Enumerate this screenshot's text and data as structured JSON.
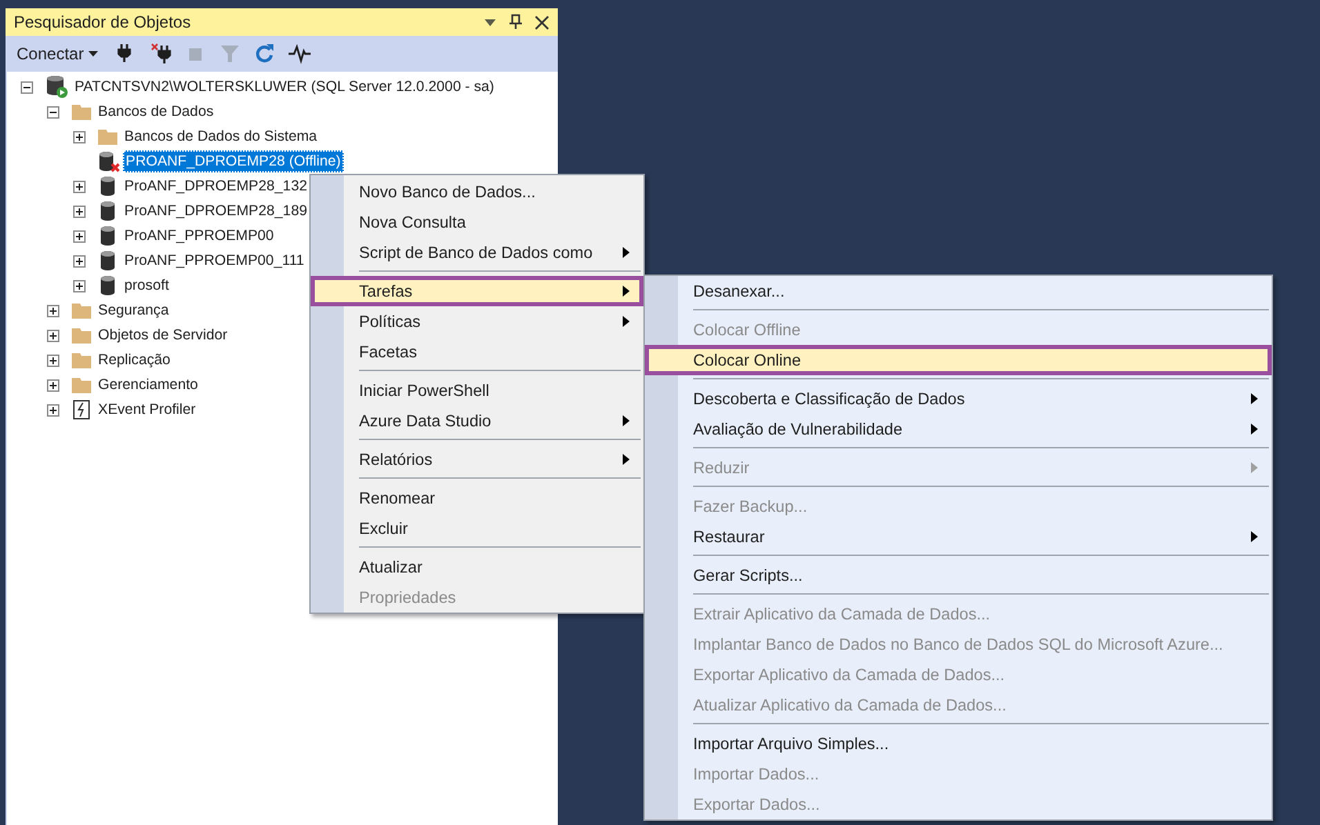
{
  "panel": {
    "title": "Pesquisador de Objetos",
    "title_controls": [
      {
        "kind": "dropdown"
      },
      {
        "kind": "pin"
      },
      {
        "kind": "close"
      }
    ],
    "toolbar": {
      "connect_label": "Conectar",
      "tools": [
        {
          "kind": "plug",
          "disabled": false
        },
        {
          "kind": "disconnect",
          "disabled": false
        },
        {
          "kind": "stop",
          "disabled": true
        },
        {
          "kind": "filter",
          "disabled": true
        },
        {
          "kind": "refresh",
          "disabled": false
        },
        {
          "kind": "activity",
          "disabled": false
        }
      ]
    },
    "tree": [
      {
        "label": "PATCNTSVN2\\WOLTERSKLUWER (SQL Server 12.0.2000 - sa)",
        "kind": "server",
        "expanded": true,
        "selected": false,
        "children": [
          {
            "label": "Bancos de Dados",
            "kind": "folder",
            "expanded": true,
            "selected": false,
            "children": [
              {
                "label": "Bancos de Dados do Sistema",
                "kind": "folder",
                "expanded": false,
                "selected": false
              },
              {
                "label": "PROANF_DPROEMP28 (Offline)",
                "kind": "database_offline",
                "selected": true
              },
              {
                "label": "ProANF_DPROEMP28_132",
                "kind": "database",
                "expanded": false,
                "selected": false
              },
              {
                "label": "ProANF_DPROEMP28_189",
                "kind": "database",
                "expanded": false,
                "selected": false
              },
              {
                "label": "ProANF_PPROEMP00",
                "kind": "database",
                "expanded": false,
                "selected": false
              },
              {
                "label": "ProANF_PPROEMP00_111",
                "kind": "database",
                "expanded": false,
                "selected": false
              },
              {
                "label": "prosoft",
                "kind": "database",
                "expanded": false,
                "selected": false
              }
            ]
          },
          {
            "label": "Segurança",
            "kind": "folder",
            "expanded": false,
            "selected": false
          },
          {
            "label": "Objetos de Servidor",
            "kind": "folder",
            "expanded": false,
            "selected": false
          },
          {
            "label": "Replicação",
            "kind": "folder",
            "expanded": false,
            "selected": false
          },
          {
            "label": "Gerenciamento",
            "kind": "folder",
            "expanded": false,
            "selected": false
          },
          {
            "label": "XEvent Profiler",
            "kind": "xevent",
            "expanded": false,
            "selected": false
          }
        ]
      }
    ]
  },
  "context_menu": {
    "items": [
      {
        "kind": "item",
        "label": "Novo Banco de Dados...",
        "disabled": false,
        "has_submenu": false,
        "selected": false
      },
      {
        "kind": "item",
        "label": "Nova Consulta",
        "disabled": false,
        "has_submenu": false,
        "selected": false
      },
      {
        "kind": "item",
        "label": "Script de Banco de Dados como",
        "disabled": false,
        "has_submenu": true,
        "selected": false
      },
      {
        "kind": "separator"
      },
      {
        "kind": "item",
        "label": "Tarefas",
        "disabled": false,
        "has_submenu": true,
        "selected": true
      },
      {
        "kind": "item",
        "label": "Políticas",
        "disabled": false,
        "has_submenu": true,
        "selected": false
      },
      {
        "kind": "item",
        "label": "Facetas",
        "disabled": false,
        "has_submenu": false,
        "selected": false
      },
      {
        "kind": "separator"
      },
      {
        "kind": "item",
        "label": "Iniciar PowerShell",
        "disabled": false,
        "has_submenu": false,
        "selected": false
      },
      {
        "kind": "item",
        "label": "Azure Data Studio",
        "disabled": false,
        "has_submenu": true,
        "selected": false
      },
      {
        "kind": "separator"
      },
      {
        "kind": "item",
        "label": "Relatórios",
        "disabled": false,
        "has_submenu": true,
        "selected": false
      },
      {
        "kind": "separator"
      },
      {
        "kind": "item",
        "label": "Renomear",
        "disabled": false,
        "has_submenu": false,
        "selected": false
      },
      {
        "kind": "item",
        "label": "Excluir",
        "disabled": false,
        "has_submenu": false,
        "selected": false
      },
      {
        "kind": "separator"
      },
      {
        "kind": "item",
        "label": "Atualizar",
        "disabled": false,
        "has_submenu": false,
        "selected": false
      },
      {
        "kind": "item",
        "label": "Propriedades",
        "disabled": true,
        "has_submenu": false,
        "selected": false
      }
    ]
  },
  "submenu": {
    "items": [
      {
        "kind": "item",
        "label": "Desanexar...",
        "disabled": false,
        "has_submenu": false,
        "selected": false
      },
      {
        "kind": "separator"
      },
      {
        "kind": "item",
        "label": "Colocar Offline",
        "disabled": true,
        "has_submenu": false,
        "selected": false
      },
      {
        "kind": "item",
        "label": "Colocar Online",
        "disabled": false,
        "has_submenu": false,
        "selected": true
      },
      {
        "kind": "separator"
      },
      {
        "kind": "item",
        "label": "Descoberta e Classificação de Dados",
        "disabled": false,
        "has_submenu": true,
        "selected": false
      },
      {
        "kind": "item",
        "label": "Avaliação de Vulnerabilidade",
        "disabled": false,
        "has_submenu": true,
        "selected": false
      },
      {
        "kind": "separator"
      },
      {
        "kind": "item",
        "label": "Reduzir",
        "disabled": true,
        "has_submenu": true,
        "selected": false
      },
      {
        "kind": "separator"
      },
      {
        "kind": "item",
        "label": "Fazer Backup...",
        "disabled": true,
        "has_submenu": false,
        "selected": false
      },
      {
        "kind": "item",
        "label": "Restaurar",
        "disabled": false,
        "has_submenu": true,
        "selected": false
      },
      {
        "kind": "separator"
      },
      {
        "kind": "item",
        "label": "Gerar Scripts...",
        "disabled": false,
        "has_submenu": false,
        "selected": false
      },
      {
        "kind": "separator"
      },
      {
        "kind": "item",
        "label": "Extrair Aplicativo da Camada de Dados...",
        "disabled": true,
        "has_submenu": false,
        "selected": false
      },
      {
        "kind": "item",
        "label": "Implantar Banco de Dados no Banco de Dados SQL do Microsoft Azure...",
        "disabled": true,
        "has_submenu": false,
        "selected": false
      },
      {
        "kind": "item",
        "label": "Exportar Aplicativo da Camada de Dados...",
        "disabled": true,
        "has_submenu": false,
        "selected": false
      },
      {
        "kind": "item",
        "label": "Atualizar Aplicativo da Camada de Dados...",
        "disabled": true,
        "has_submenu": false,
        "selected": false
      },
      {
        "kind": "separator"
      },
      {
        "kind": "item",
        "label": "Importar Arquivo Simples...",
        "disabled": false,
        "has_submenu": false,
        "selected": false
      },
      {
        "kind": "item",
        "label": "Importar Dados...",
        "disabled": true,
        "has_submenu": false,
        "selected": false
      },
      {
        "kind": "item",
        "label": "Exportar Dados...",
        "disabled": true,
        "has_submenu": false,
        "selected": false
      }
    ]
  }
}
